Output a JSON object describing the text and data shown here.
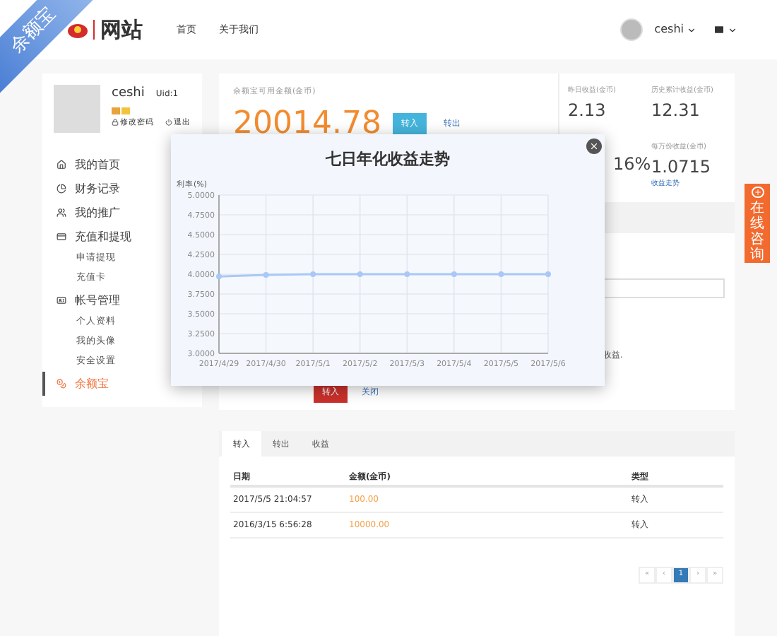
{
  "ribbon": {
    "text": "余额宝"
  },
  "header": {
    "logo_text": "网站",
    "nav": [
      {
        "label": "首页"
      },
      {
        "label": "关于我们"
      }
    ],
    "user": "ceshi"
  },
  "profile": {
    "name": "ceshi",
    "uid": "Uid:1",
    "links": [
      "修改密码",
      "退出"
    ]
  },
  "sidebar": {
    "items": [
      {
        "label": "我的首页",
        "selected": false
      },
      {
        "label": "财务记录",
        "selected": false
      },
      {
        "label": "我的推广",
        "selected": false
      },
      {
        "label": "充值和提现",
        "selected": false,
        "children": [
          {
            "label": "申请提现"
          },
          {
            "label": "充值卡"
          }
        ]
      },
      {
        "label": "帐号管理",
        "selected": false,
        "children": [
          {
            "label": "个人资料"
          },
          {
            "label": "我的头像"
          },
          {
            "label": "安全设置"
          }
        ]
      },
      {
        "label": "余额宝",
        "selected": true
      }
    ]
  },
  "balance": {
    "label": "余额宝可用金额(金币)",
    "amount": "20014.78",
    "buttons": [
      "转入",
      "转出"
    ]
  },
  "stats": [
    {
      "label": "昨日收益(金币)",
      "value": "2.13"
    },
    {
      "label": "历史累计收益(金币)",
      "value": "12.31"
    },
    {
      "value": "16%"
    },
    {
      "label": "每万份收益(金币)",
      "value": "1.0715",
      "link": "收益走势"
    }
  ],
  "form": {
    "note": "收益.",
    "buttons": [
      "转入",
      "关闭"
    ]
  },
  "modal": {
    "title": "七日年化收益走势",
    "chart_data": {
      "type": "line",
      "ylabel": "利率(%)",
      "categories": [
        "2017/4/29",
        "2017/4/30",
        "2017/5/1",
        "2017/5/2",
        "2017/5/3",
        "2017/5/4",
        "2017/5/5",
        "2017/5/6"
      ],
      "grid": true,
      "series": [
        {
          "marker": true,
          "color": "#a9c8f5",
          "values": [
            3.97,
            3.99,
            4.0,
            4.0,
            4.0,
            4.0,
            4.0,
            4.0
          ]
        }
      ],
      "ylim": [
        3,
        5
      ],
      "yticks": [
        {
          "value": 3,
          "label": "3.0000"
        },
        {
          "value": 3.25,
          "label": "3.2500"
        },
        {
          "value": 3.5,
          "label": "3.5000"
        },
        {
          "value": 3.75,
          "label": "3.7500"
        },
        {
          "value": 4,
          "label": "4.0000"
        },
        {
          "value": 4.25,
          "label": "4.2500"
        },
        {
          "value": 4.5,
          "label": "4.5000"
        },
        {
          "value": 4.75,
          "label": "4.7500"
        },
        {
          "value": 5,
          "label": "5.0000"
        }
      ]
    }
  },
  "tabs": [
    {
      "label": "转入",
      "selected": true
    },
    {
      "label": "转出",
      "selected": false
    },
    {
      "label": "收益",
      "selected": false
    }
  ],
  "table": {
    "columns": [
      "日期",
      "金额(金币)",
      "类型"
    ],
    "rows": [
      [
        "2017/5/5 21:04:57",
        "100.00",
        "转入"
      ],
      [
        "2016/3/15 6:56:28",
        "10000.00",
        "转入"
      ]
    ]
  },
  "pagination": [
    {
      "label": "«",
      "selected": false
    },
    {
      "label": "‹",
      "selected": false
    },
    {
      "label": "1",
      "selected": true
    },
    {
      "label": "›",
      "selected": false
    },
    {
      "label": "»",
      "selected": false
    }
  ],
  "consult": {
    "text": "在线咨询"
  }
}
